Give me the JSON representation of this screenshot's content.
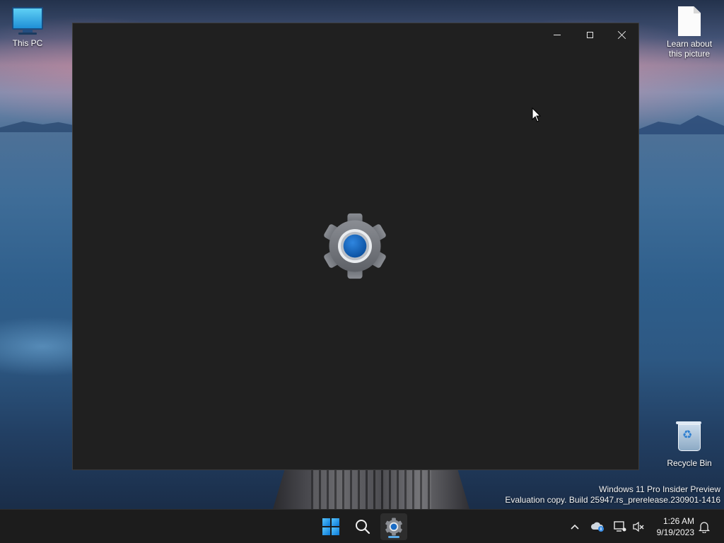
{
  "desktop": {
    "icons": [
      {
        "label": "This PC",
        "icon": "monitor-icon"
      },
      {
        "label": "Learn about this picture",
        "icon": "document-icon"
      },
      {
        "label": "Recycle Bin",
        "icon": "recycle-bin-icon"
      }
    ],
    "watermark": {
      "line1": "Windows 11 Pro Insider Preview",
      "line2": "Evaluation copy. Build 25947.rs_prerelease.230901-1416"
    }
  },
  "window": {
    "app": "Settings",
    "splash_icon": "settings-gear-icon",
    "controls": [
      "minimize-icon",
      "maximize-icon",
      "close-icon"
    ],
    "background_color": "#202020"
  },
  "taskbar": {
    "apps": [
      {
        "name": "Start",
        "icon": "windows-start-icon"
      },
      {
        "name": "Search",
        "icon": "search-icon"
      },
      {
        "name": "Settings",
        "icon": "settings-gear-icon",
        "active": true
      }
    ],
    "tray": {
      "icons": [
        "chevron-up-icon",
        "onedrive-cloud-icon",
        "network-icon",
        "volume-muted-icon",
        "notification-bell-icon"
      ],
      "time": "1:26 AM",
      "date": "9/19/2023"
    },
    "accent_color": "#0a78d6"
  }
}
